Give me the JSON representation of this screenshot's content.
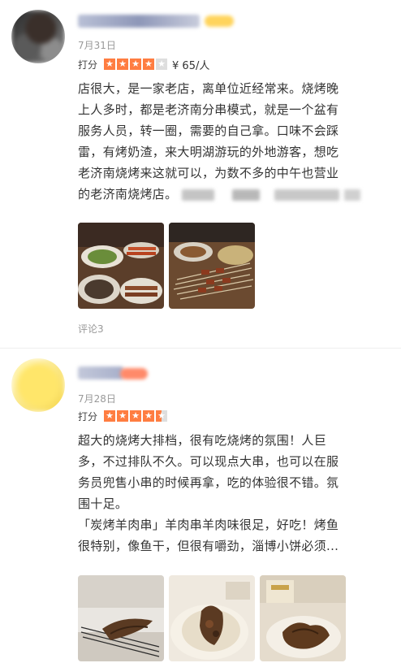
{
  "reviews": [
    {
      "date": "7月31日",
      "rating_label": "打分",
      "stars": 4,
      "price": "¥ 65/人",
      "lines": [
        "店很大，是一家老店，离单位近经常来。烧烤晚",
        "上人多时，都是老济南分串模式，就是一个盆有",
        "服务人员，转一圈，需要的自己拿。口味不会踩",
        "雷，有烤奶渣，来大明湖游玩的外地游客，想吃",
        "老济南烧烤来这就可以，为数不多的中午也营业",
        "的老济南烧烤店。"
      ],
      "comments": "评论3",
      "photos": [
        "bbq-table-photo",
        "skewers-pile-photo"
      ]
    },
    {
      "date": "7月28日",
      "rating_label": "打分",
      "stars": 4.5,
      "lines": [
        "超大的烧烤大排档，很有吃烧烤的氛围！人巨",
        "多，不过排队不久。可以现点大串，也可以在服",
        "务员兜售小串的时候再拿，吃的体验很不错。氛",
        "围十足。",
        "「炭烤羊肉串」羊肉串羊肉味很足，好吃！烤鱼",
        "很特别，像鱼干，但很有嚼劲，淄博小饼必须..."
      ],
      "photos": [
        "grilled-fish-photo",
        "pancake-wrap-photo",
        "meat-plate-photo"
      ]
    }
  ],
  "colors": {
    "star": "#ff7d41",
    "star_empty": "#dedede",
    "muted": "#999999"
  }
}
